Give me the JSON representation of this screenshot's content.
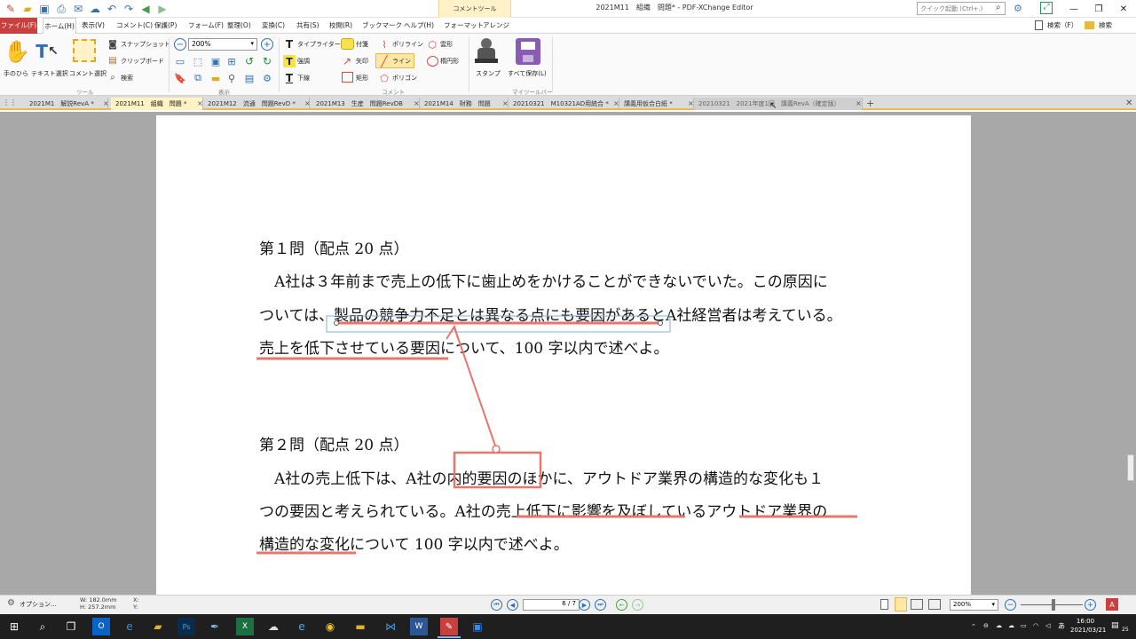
{
  "window": {
    "title": "2021M11　組織　問題* - PDF-XChange Editor",
    "quick_search_placeholder": "クイック起動 (Ctrl+.)"
  },
  "menu": {
    "file": "ファイル(F)",
    "home": "ホーム(H)",
    "items": [
      "表示(V)",
      "コメント(C)",
      "保護(P)",
      "フォーム(F)",
      "整理(O)",
      "変換(C)",
      "共有(S)",
      "校閲(R)",
      "ブックマーク",
      "ヘルプ(H)"
    ],
    "context_title": "コメントツール",
    "context_items": [
      "フォーマット",
      "アレンジ"
    ],
    "search1": "検索（F）",
    "search2": "検索"
  },
  "ribbon": {
    "hand": "手のひら",
    "text_select": "テキスト選択",
    "comment_select": "コメント選択",
    "tools_group": "ツール",
    "snapshot": "スナップショット",
    "clipboard": "クリップボード",
    "search": "検索",
    "zoom": "200%",
    "view_group": "表示",
    "typewriter": "タイプライター",
    "highlight": "強調",
    "underline": "下線",
    "sticky": "付箋",
    "arrow": "矢印",
    "rect": "矩形",
    "polyline": "ポリライン",
    "line": "ライン",
    "polygon": "ポリゴン",
    "cloud": "雲形",
    "oval": "楕円形",
    "comment_group": "コメント",
    "stamp": "スタンプ",
    "save_all": "すべて保存(L)",
    "my_toolbar": "マイツールバー"
  },
  "tabs": [
    {
      "label": "2021M1　解説RevA *"
    },
    {
      "label": "2021M11　組織　問題 *"
    },
    {
      "label": "2021M12　流通　問題RevD *"
    },
    {
      "label": "2021M13　生産　問題RevDB"
    },
    {
      "label": "2021M14　財務　問題"
    },
    {
      "label": "20210321　M10321AD用統合 *"
    },
    {
      "label": "講義用仮合白紙 *"
    },
    {
      "label": "20210321　2021年度1回　講義RevA（確定版）"
    }
  ],
  "document": {
    "q1_title": "第１問（配点 20 点）",
    "q1_line1": "　A社は３年前まで売上の低下に歯止めをかけることができないでいた。この原因に",
    "q1_line2": "ついては、製品の競争力不足とは異なる点にも要因があるとA社経営者は考えている。",
    "q1_line3": "売上を低下させている要因について、100 字以内で述べよ。",
    "q2_title": "第２問（配点 20 点）",
    "q2_line1": "　A社の売上低下は、A社の内的要因のほかに、アウトドア業界の構造的な変化も１",
    "q2_line2": "つの要因と考えられている。A社の売上低下に影響を及ぼしているアウトドア業界の",
    "q2_line3": "構造的な変化について 100 字以内で述べよ。"
  },
  "status": {
    "options": "オプション...",
    "width": "W: 182.0mm",
    "height": "H: 257.2mm",
    "x": "X:",
    "y": "Y:",
    "page": "6 / 7",
    "zoom": "200%"
  },
  "taskbar": {
    "time": "16:00",
    "date": "2021/03/21",
    "ime": "あ",
    "notif": "25"
  },
  "colors": {
    "accent": "#c8413f",
    "annotation": "#e8766b",
    "context_band": "#fff2c8",
    "page_bg": "#a8a8a8"
  }
}
